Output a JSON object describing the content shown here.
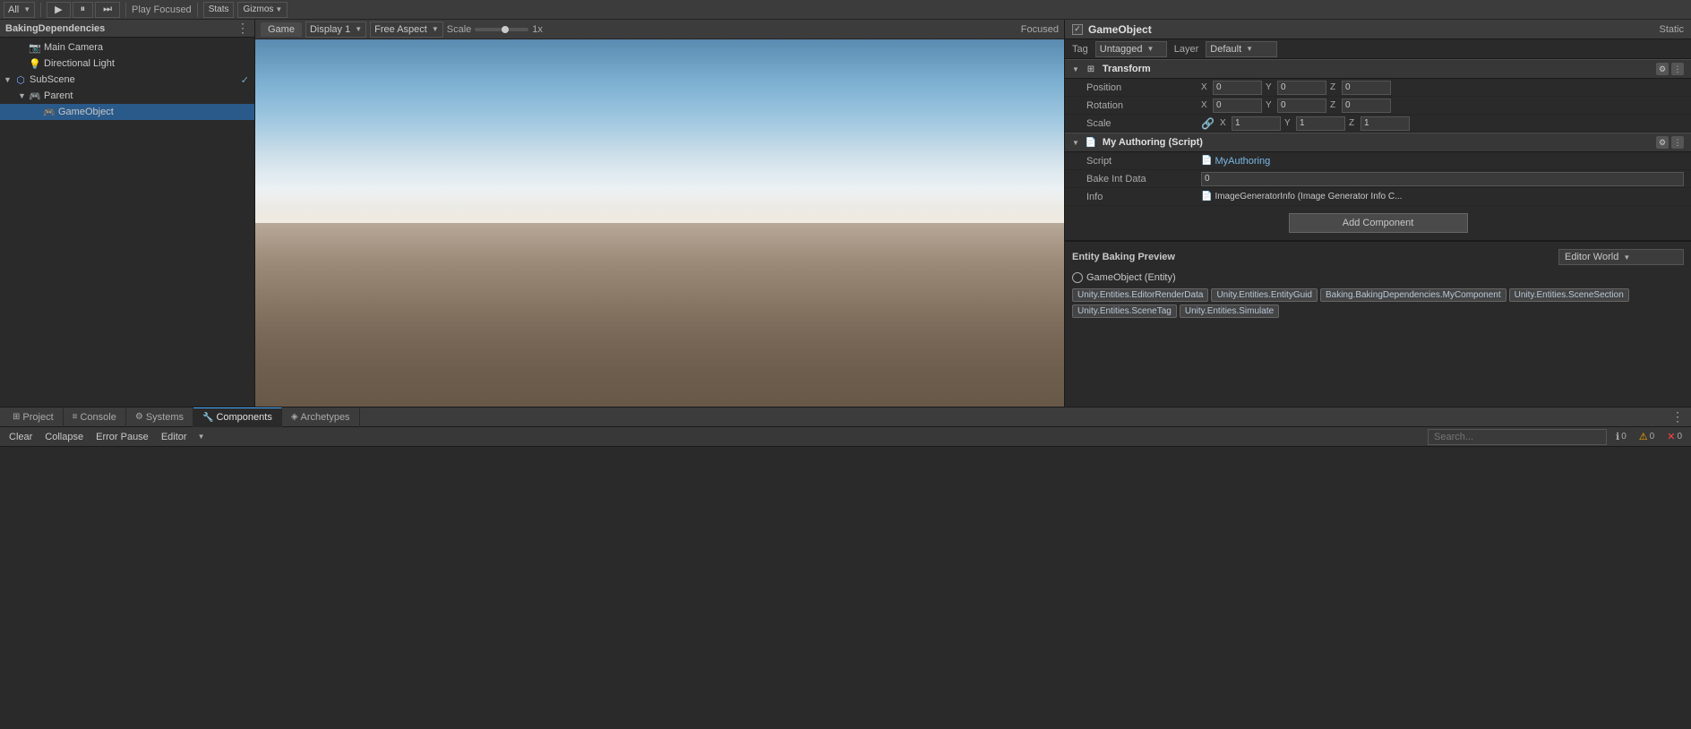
{
  "top_toolbar": {
    "all_btn": "All",
    "play_label": "Play Focused",
    "stats_label": "Stats",
    "gizmos_label": "Gizmos"
  },
  "game_toolbar": {
    "tab_label": "Game",
    "display": "Display 1",
    "aspect": "Free Aspect",
    "scale_label": "Scale",
    "scale_value": "1x",
    "focused_label": "Focused"
  },
  "hierarchy": {
    "title": "BakingDependencies",
    "items": [
      {
        "label": "Main Camera",
        "indent": 1,
        "icon": "camera",
        "has_arrow": false,
        "selected": false
      },
      {
        "label": "Directional Light",
        "indent": 1,
        "icon": "light",
        "has_arrow": false,
        "selected": false
      },
      {
        "label": "SubScene",
        "indent": 0,
        "icon": "subscene",
        "has_arrow": true,
        "selected": false,
        "checked": true
      },
      {
        "label": "Parent",
        "indent": 1,
        "icon": "parent",
        "has_arrow": true,
        "selected": false
      },
      {
        "label": "GameObject",
        "indent": 2,
        "icon": "gameobject",
        "has_arrow": false,
        "selected": true
      }
    ]
  },
  "inspector": {
    "object_name": "GameObject",
    "static_label": "Static",
    "tag_label": "Tag",
    "tag_value": "Untagged",
    "layer_label": "Layer",
    "layer_value": "Default",
    "transform": {
      "title": "Transform",
      "position_label": "Position",
      "pos_x": "0",
      "pos_y": "0",
      "pos_z": "0",
      "rotation_label": "Rotation",
      "rot_x": "0",
      "rot_y": "0",
      "rot_z": "0",
      "scale_label": "Scale",
      "scale_x": "1",
      "scale_y": "1",
      "scale_z": "1"
    },
    "my_authoring": {
      "title": "My Authoring (Script)",
      "script_label": "Script",
      "script_value": "MyAuthoring",
      "bake_int_label": "Bake Int Data",
      "bake_int_value": "0",
      "info_label": "Info",
      "info_value": "ImageGeneratorInfo (Image Generator Info C..."
    },
    "add_component": "Add Component"
  },
  "entity_baking": {
    "title": "Entity Baking Preview",
    "editor_world_label": "Editor World",
    "entity_name": "GameObject (Entity)",
    "tags": [
      "Unity.Entities.EditorRenderData",
      "Unity.Entities.EntityGuid",
      "Baking.BakingDependencies.MyComponent",
      "Unity.Entities.SceneSection",
      "Unity.Entities.SceneTag",
      "Unity.Entities.Simulate"
    ]
  },
  "bottom_tabs": {
    "tabs": [
      {
        "label": "Project",
        "icon": "grid"
      },
      {
        "label": "Console",
        "icon": "list"
      },
      {
        "label": "Systems",
        "icon": "settings"
      },
      {
        "label": "Components",
        "icon": "puzzle"
      },
      {
        "label": "Archetypes",
        "icon": "layers"
      }
    ],
    "active_tab": "Components"
  },
  "bottom_toolbar": {
    "clear_btn": "Clear",
    "collapse_btn": "Collapse",
    "error_pause_btn": "Error Pause",
    "editor_btn": "Editor",
    "badges": {
      "info": "0",
      "warn": "0",
      "error": "0"
    }
  }
}
